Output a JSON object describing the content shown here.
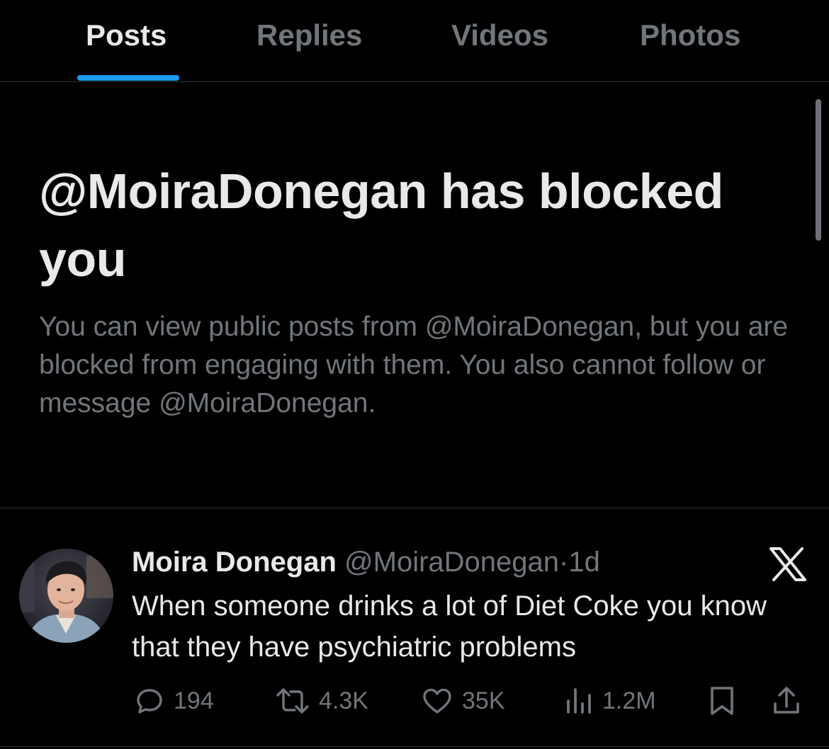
{
  "tabs": [
    {
      "label": "Posts",
      "active": true
    },
    {
      "label": "Replies",
      "active": false
    },
    {
      "label": "Videos",
      "active": false
    },
    {
      "label": "Photos",
      "active": false
    }
  ],
  "blocked": {
    "title": "@MoiraDonegan has blocked you",
    "body": "You can view public posts from @MoiraDonegan, but you are blocked from engaging with them. You also cannot follow or message @MoiraDonegan."
  },
  "tweet": {
    "name": "Moira Donegan",
    "handle": "@MoiraDonegan",
    "separator": "·",
    "time": "1d",
    "text": "When someone drinks a lot of Diet Coke you know that they have psychiatric problems",
    "actions": {
      "replies": "194",
      "reposts": "4.3K",
      "likes": "35K",
      "views": "1.2M"
    },
    "icons": {
      "reply": "reply-icon",
      "repost": "repost-icon",
      "like": "heart-icon",
      "views": "views-icon",
      "bookmark": "bookmark-icon",
      "share": "share-icon",
      "source": "x-logo-icon"
    }
  },
  "colors": {
    "background": "#000000",
    "text_primary": "#e7e9ea",
    "text_secondary": "#71767b",
    "accent": "#1d9bf0",
    "divider": "#2f3336"
  }
}
